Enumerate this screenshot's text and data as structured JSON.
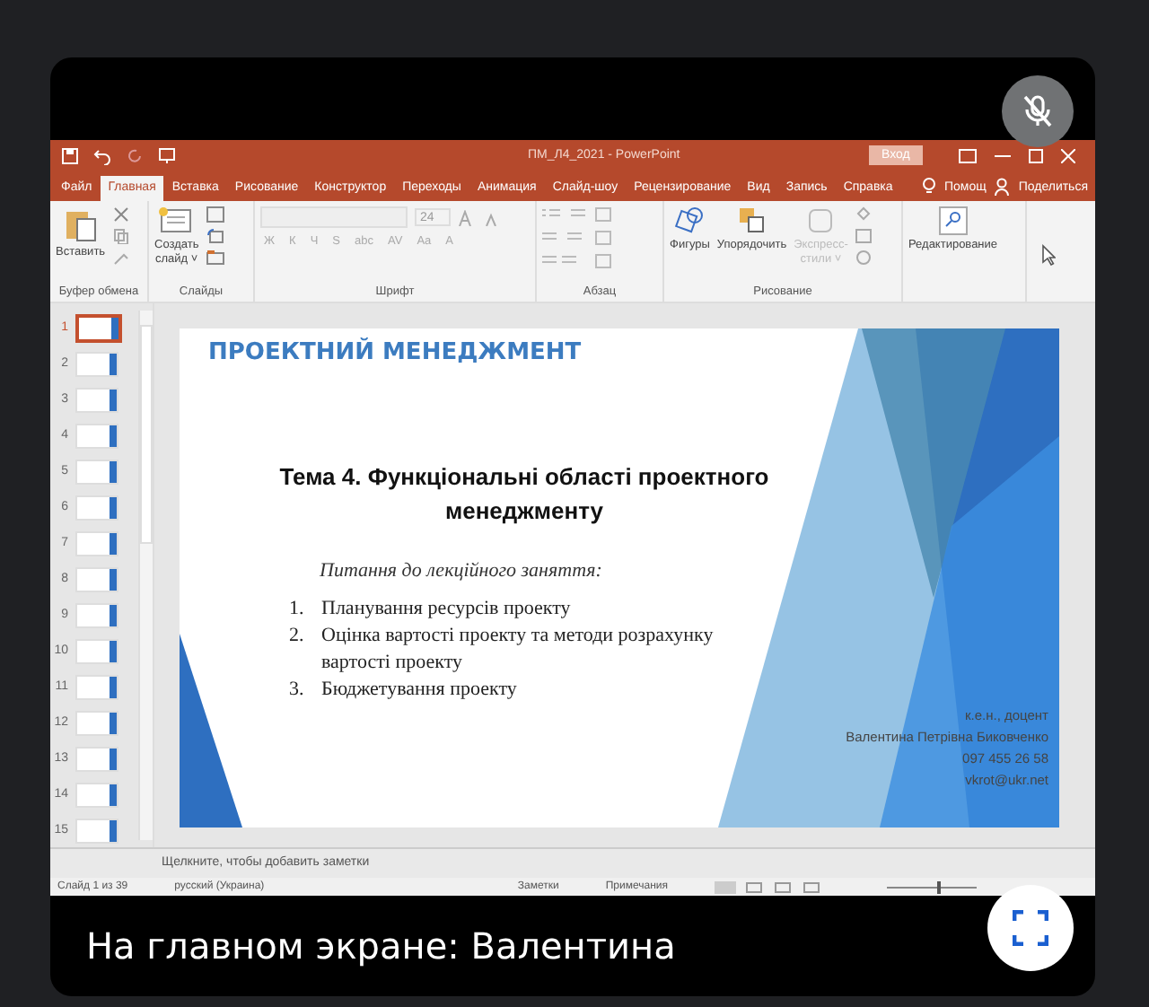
{
  "window": {
    "title": "ПМ_Л4_2021  -  PowerPoint",
    "sign_in": "Вход"
  },
  "tabs": [
    {
      "label": "Файл",
      "selected": false
    },
    {
      "label": "Главная",
      "selected": true
    },
    {
      "label": "Вставка",
      "selected": false
    },
    {
      "label": "Рисование",
      "selected": false
    },
    {
      "label": "Конструктор",
      "selected": false
    },
    {
      "label": "Переходы",
      "selected": false
    },
    {
      "label": "Анимация",
      "selected": false
    },
    {
      "label": "Слайд-шоу",
      "selected": false
    },
    {
      "label": "Рецензирование",
      "selected": false
    },
    {
      "label": "Вид",
      "selected": false
    },
    {
      "label": "Запись",
      "selected": false
    },
    {
      "label": "Справка",
      "selected": false
    }
  ],
  "help": "Помощ",
  "share": "Поделиться",
  "ribbon": {
    "clipboard": {
      "paste": "Вставить",
      "label": "Буфер обмена"
    },
    "slides": {
      "new_slide": [
        "Создать",
        "слайд ˅"
      ],
      "label": "Слайды"
    },
    "font": {
      "size": "24",
      "buttons": [
        "Ж",
        "К",
        "Ч",
        "S",
        "abc",
        "AV",
        "Aa",
        "A"
      ],
      "label": "Шрифт"
    },
    "paragraph": {
      "label": "Абзац"
    },
    "drawing": {
      "shapes": "Фигуры",
      "arrange": "Упорядочить",
      "styles": [
        "Экспресс-",
        "стили ˅"
      ],
      "label": "Рисование"
    },
    "editing": {
      "label": "Редактирование"
    }
  },
  "thumbnails": [
    {
      "number": "1",
      "selected": true
    },
    {
      "number": "2",
      "selected": false
    },
    {
      "number": "3",
      "selected": false
    },
    {
      "number": "4",
      "selected": false
    },
    {
      "number": "5",
      "selected": false
    },
    {
      "number": "6",
      "selected": false
    },
    {
      "number": "7",
      "selected": false
    },
    {
      "number": "8",
      "selected": false
    },
    {
      "number": "9",
      "selected": false
    },
    {
      "number": "10",
      "selected": false
    },
    {
      "number": "11",
      "selected": false
    },
    {
      "number": "12",
      "selected": false
    },
    {
      "number": "13",
      "selected": false
    },
    {
      "number": "14",
      "selected": false
    },
    {
      "number": "15",
      "selected": false
    }
  ],
  "slide": {
    "header": "ПРОЕКТНИЙ МЕНЕДЖМЕНТ",
    "title": "Тема 4. Функціональні області проектного менеджменту",
    "subtitle": "Питання до лекційного заняття:",
    "items": [
      {
        "number": "1.",
        "text": "Планування ресурсів проекту"
      },
      {
        "number": "2.",
        "text": "Оцінка вартості проекту та  методи розрахунку вартості проекту"
      },
      {
        "number": "3.",
        "text": "Бюджетування проекту"
      }
    ],
    "author": [
      "к.е.н., доцент",
      "Валентина Петрівна Биковченко",
      "097 455 26 58",
      "vkrot@ukr.net"
    ]
  },
  "notes_placeholder": "Щелкните, чтобы добавить заметки",
  "status_bar": {
    "slide": "Слайд 1 из 39",
    "language": "русский (Украина)",
    "notes": "Заметки",
    "comments": "Примечания",
    "zoom": {
      "level": 0.55
    }
  },
  "caption": "На главном экране: Валентина"
}
